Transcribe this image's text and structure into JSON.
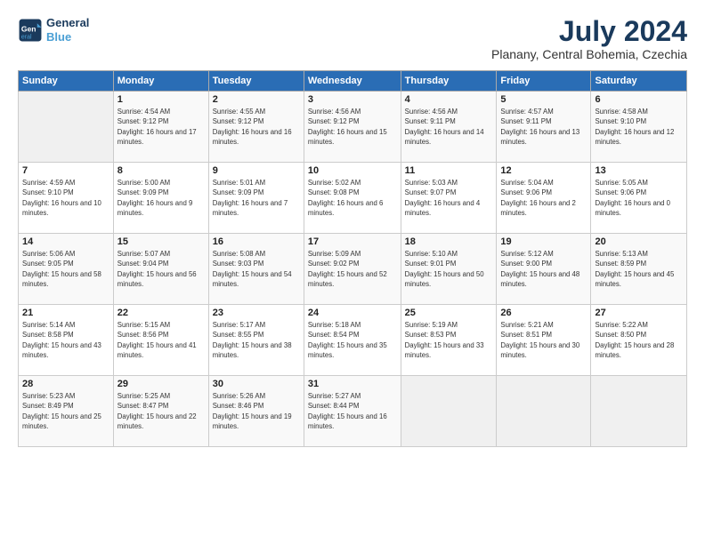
{
  "header": {
    "logo_line1": "General",
    "logo_line2": "Blue",
    "month_year": "July 2024",
    "location": "Planany, Central Bohemia, Czechia"
  },
  "weekdays": [
    "Sunday",
    "Monday",
    "Tuesday",
    "Wednesday",
    "Thursday",
    "Friday",
    "Saturday"
  ],
  "weeks": [
    [
      {
        "day": "",
        "sunrise": "",
        "sunset": "",
        "daylight": ""
      },
      {
        "day": "1",
        "sunrise": "Sunrise: 4:54 AM",
        "sunset": "Sunset: 9:12 PM",
        "daylight": "Daylight: 16 hours and 17 minutes."
      },
      {
        "day": "2",
        "sunrise": "Sunrise: 4:55 AM",
        "sunset": "Sunset: 9:12 PM",
        "daylight": "Daylight: 16 hours and 16 minutes."
      },
      {
        "day": "3",
        "sunrise": "Sunrise: 4:56 AM",
        "sunset": "Sunset: 9:12 PM",
        "daylight": "Daylight: 16 hours and 15 minutes."
      },
      {
        "day": "4",
        "sunrise": "Sunrise: 4:56 AM",
        "sunset": "Sunset: 9:11 PM",
        "daylight": "Daylight: 16 hours and 14 minutes."
      },
      {
        "day": "5",
        "sunrise": "Sunrise: 4:57 AM",
        "sunset": "Sunset: 9:11 PM",
        "daylight": "Daylight: 16 hours and 13 minutes."
      },
      {
        "day": "6",
        "sunrise": "Sunrise: 4:58 AM",
        "sunset": "Sunset: 9:10 PM",
        "daylight": "Daylight: 16 hours and 12 minutes."
      }
    ],
    [
      {
        "day": "7",
        "sunrise": "Sunrise: 4:59 AM",
        "sunset": "Sunset: 9:10 PM",
        "daylight": "Daylight: 16 hours and 10 minutes."
      },
      {
        "day": "8",
        "sunrise": "Sunrise: 5:00 AM",
        "sunset": "Sunset: 9:09 PM",
        "daylight": "Daylight: 16 hours and 9 minutes."
      },
      {
        "day": "9",
        "sunrise": "Sunrise: 5:01 AM",
        "sunset": "Sunset: 9:09 PM",
        "daylight": "Daylight: 16 hours and 7 minutes."
      },
      {
        "day": "10",
        "sunrise": "Sunrise: 5:02 AM",
        "sunset": "Sunset: 9:08 PM",
        "daylight": "Daylight: 16 hours and 6 minutes."
      },
      {
        "day": "11",
        "sunrise": "Sunrise: 5:03 AM",
        "sunset": "Sunset: 9:07 PM",
        "daylight": "Daylight: 16 hours and 4 minutes."
      },
      {
        "day": "12",
        "sunrise": "Sunrise: 5:04 AM",
        "sunset": "Sunset: 9:06 PM",
        "daylight": "Daylight: 16 hours and 2 minutes."
      },
      {
        "day": "13",
        "sunrise": "Sunrise: 5:05 AM",
        "sunset": "Sunset: 9:06 PM",
        "daylight": "Daylight: 16 hours and 0 minutes."
      }
    ],
    [
      {
        "day": "14",
        "sunrise": "Sunrise: 5:06 AM",
        "sunset": "Sunset: 9:05 PM",
        "daylight": "Daylight: 15 hours and 58 minutes."
      },
      {
        "day": "15",
        "sunrise": "Sunrise: 5:07 AM",
        "sunset": "Sunset: 9:04 PM",
        "daylight": "Daylight: 15 hours and 56 minutes."
      },
      {
        "day": "16",
        "sunrise": "Sunrise: 5:08 AM",
        "sunset": "Sunset: 9:03 PM",
        "daylight": "Daylight: 15 hours and 54 minutes."
      },
      {
        "day": "17",
        "sunrise": "Sunrise: 5:09 AM",
        "sunset": "Sunset: 9:02 PM",
        "daylight": "Daylight: 15 hours and 52 minutes."
      },
      {
        "day": "18",
        "sunrise": "Sunrise: 5:10 AM",
        "sunset": "Sunset: 9:01 PM",
        "daylight": "Daylight: 15 hours and 50 minutes."
      },
      {
        "day": "19",
        "sunrise": "Sunrise: 5:12 AM",
        "sunset": "Sunset: 9:00 PM",
        "daylight": "Daylight: 15 hours and 48 minutes."
      },
      {
        "day": "20",
        "sunrise": "Sunrise: 5:13 AM",
        "sunset": "Sunset: 8:59 PM",
        "daylight": "Daylight: 15 hours and 45 minutes."
      }
    ],
    [
      {
        "day": "21",
        "sunrise": "Sunrise: 5:14 AM",
        "sunset": "Sunset: 8:58 PM",
        "daylight": "Daylight: 15 hours and 43 minutes."
      },
      {
        "day": "22",
        "sunrise": "Sunrise: 5:15 AM",
        "sunset": "Sunset: 8:56 PM",
        "daylight": "Daylight: 15 hours and 41 minutes."
      },
      {
        "day": "23",
        "sunrise": "Sunrise: 5:17 AM",
        "sunset": "Sunset: 8:55 PM",
        "daylight": "Daylight: 15 hours and 38 minutes."
      },
      {
        "day": "24",
        "sunrise": "Sunrise: 5:18 AM",
        "sunset": "Sunset: 8:54 PM",
        "daylight": "Daylight: 15 hours and 35 minutes."
      },
      {
        "day": "25",
        "sunrise": "Sunrise: 5:19 AM",
        "sunset": "Sunset: 8:53 PM",
        "daylight": "Daylight: 15 hours and 33 minutes."
      },
      {
        "day": "26",
        "sunrise": "Sunrise: 5:21 AM",
        "sunset": "Sunset: 8:51 PM",
        "daylight": "Daylight: 15 hours and 30 minutes."
      },
      {
        "day": "27",
        "sunrise": "Sunrise: 5:22 AM",
        "sunset": "Sunset: 8:50 PM",
        "daylight": "Daylight: 15 hours and 28 minutes."
      }
    ],
    [
      {
        "day": "28",
        "sunrise": "Sunrise: 5:23 AM",
        "sunset": "Sunset: 8:49 PM",
        "daylight": "Daylight: 15 hours and 25 minutes."
      },
      {
        "day": "29",
        "sunrise": "Sunrise: 5:25 AM",
        "sunset": "Sunset: 8:47 PM",
        "daylight": "Daylight: 15 hours and 22 minutes."
      },
      {
        "day": "30",
        "sunrise": "Sunrise: 5:26 AM",
        "sunset": "Sunset: 8:46 PM",
        "daylight": "Daylight: 15 hours and 19 minutes."
      },
      {
        "day": "31",
        "sunrise": "Sunrise: 5:27 AM",
        "sunset": "Sunset: 8:44 PM",
        "daylight": "Daylight: 15 hours and 16 minutes."
      },
      {
        "day": "",
        "sunrise": "",
        "sunset": "",
        "daylight": ""
      },
      {
        "day": "",
        "sunrise": "",
        "sunset": "",
        "daylight": ""
      },
      {
        "day": "",
        "sunrise": "",
        "sunset": "",
        "daylight": ""
      }
    ]
  ]
}
